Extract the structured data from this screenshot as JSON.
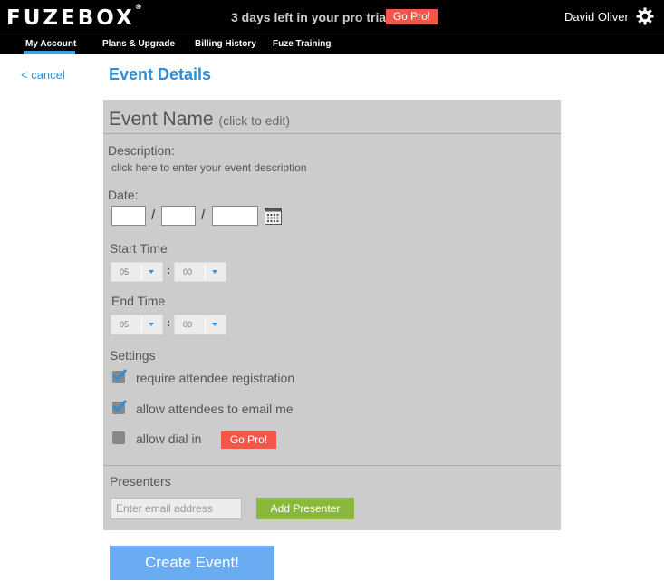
{
  "header": {
    "logo": "FUZEBOX",
    "logo_mark": "®",
    "trial_text": "3 days left in your pro trial",
    "go_pro_label": "Go Pro!",
    "user_name": "David Oliver"
  },
  "nav": {
    "items": [
      {
        "label": "My Account"
      },
      {
        "label": "Plans & Upgrade"
      },
      {
        "label": "Billing History"
      },
      {
        "label": "Fuze Training"
      }
    ]
  },
  "page": {
    "cancel_label": "< cancel",
    "title": "Event Details"
  },
  "form": {
    "event_name": "Event Name",
    "event_name_hint": "(click to edit)",
    "description_label": "Description:",
    "description_placeholder": "click here to enter your event description",
    "date_label": "Date:",
    "date_separator": "/",
    "start_time_label": "Start Time",
    "end_time_label": "End Time",
    "start_hour": "05",
    "start_minute": "00",
    "end_hour": "05",
    "end_minute": "00",
    "time_separator": ":",
    "settings_label": "Settings",
    "settings": [
      {
        "label": "require attendee registration",
        "checked": true
      },
      {
        "label": "allow attendees to email me",
        "checked": true
      },
      {
        "label": "allow dial in",
        "checked": false
      }
    ],
    "dial_in_go_pro": "Go Pro!",
    "presenters_label": "Presenters",
    "email_placeholder": "Enter email address",
    "add_presenter_label": "Add Presenter"
  },
  "create_label": "Create Event!",
  "colors": {
    "accent": "#2e8fd6",
    "go_pro": "#f5564a",
    "add_button": "#8ab83b",
    "create_button": "#6aacf2",
    "panel": "#cccccc"
  }
}
